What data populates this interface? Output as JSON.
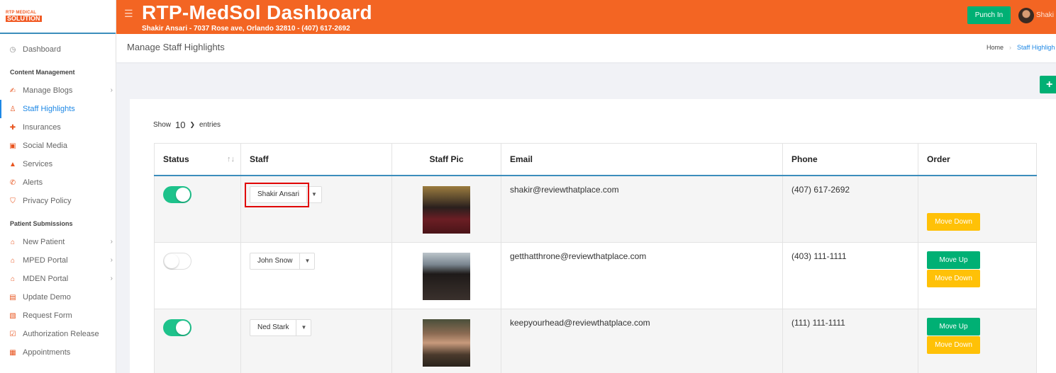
{
  "sidebar": {
    "logo": {
      "line1": "RTP MEDICAL",
      "line2": "SOLUTION"
    },
    "dashboard": {
      "label": "Dashboard",
      "icon": "gauge-icon"
    },
    "section1": "Content Management",
    "content_items": [
      {
        "label": "Manage Blogs",
        "icon": "blog-icon",
        "has_children": true
      },
      {
        "label": "Staff Highlights",
        "icon": "user-icon",
        "active": true
      },
      {
        "label": "Insurances",
        "icon": "medkit-icon"
      },
      {
        "label": "Social Media",
        "icon": "images-icon"
      },
      {
        "label": "Services",
        "icon": "services-icon"
      },
      {
        "label": "Alerts",
        "icon": "phone-icon"
      },
      {
        "label": "Privacy Policy",
        "icon": "shield-icon"
      }
    ],
    "section2": "Patient Submissions",
    "patient_items": [
      {
        "label": "New Patient",
        "icon": "home-icon",
        "has_children": true
      },
      {
        "label": "MPED Portal",
        "icon": "home-icon",
        "has_children": true
      },
      {
        "label": "MDEN Portal",
        "icon": "home-icon",
        "has_children": true
      },
      {
        "label": "Update Demo",
        "icon": "id-card-icon"
      },
      {
        "label": "Request Form",
        "icon": "document-icon"
      },
      {
        "label": "Authorization Release",
        "icon": "check-square-icon"
      },
      {
        "label": "Appointments",
        "icon": "calendar-icon"
      }
    ]
  },
  "header": {
    "title": "RTP-MedSol Dashboard",
    "subtitle": "Shakir Ansari - 7037 Rose ave, Orlando 32810 - (407) 617-2692",
    "punch_label": "Punch In",
    "user_name": "Shaki"
  },
  "page": {
    "title": "Manage Staff Highlights",
    "breadcrumb": [
      "Home",
      "Staff Highligh"
    ],
    "add_label": "+"
  },
  "table": {
    "show_label": "Show",
    "entries_value": "10",
    "entries_label": "entries",
    "columns": [
      "Status",
      "Staff",
      "Staff Pic",
      "Email",
      "Phone",
      "Order"
    ],
    "rows": [
      {
        "status": true,
        "staff": "Shakir Ansari",
        "email": "shakir@reviewthatplace.com",
        "phone": "(407) 617-2692",
        "move_up": "",
        "move_down": "Move Down"
      },
      {
        "status": false,
        "staff": "John Snow",
        "email": "getthatthrone@reviewthatplace.com",
        "phone": "(403) 111-1111",
        "move_up": "Move Up",
        "move_down": "Move Down"
      },
      {
        "status": true,
        "staff": "Ned Stark",
        "email": "keepyourhead@reviewthatplace.com",
        "phone": "(111) 111-1111",
        "move_up": "Move Up",
        "move_down": "Move Down"
      }
    ]
  },
  "colors": {
    "header": "#f36523",
    "accent_green": "#00b074",
    "toggle_on": "#1ec28b",
    "move_down": "#ffc107",
    "highlight": "#e00000"
  }
}
